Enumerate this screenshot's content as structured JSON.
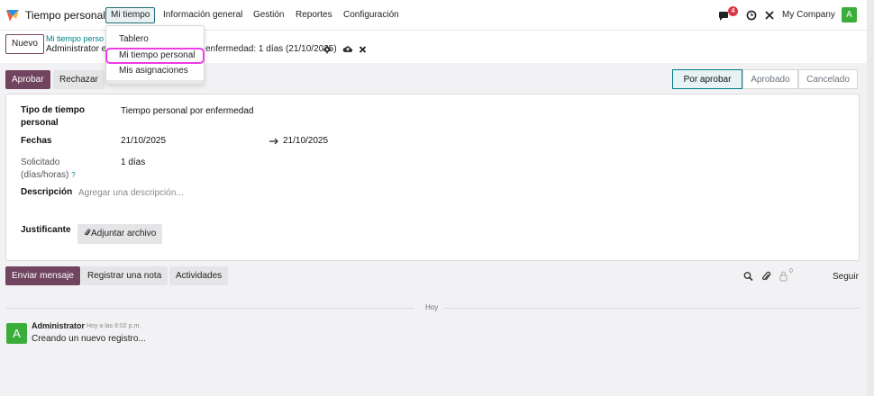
{
  "navbar": {
    "app_name": "Tiempo personal",
    "menu": [
      "Mi tiempo",
      "Información general",
      "Gestión",
      "Reportes",
      "Configuración"
    ],
    "message_count": "4",
    "company": "My Company",
    "user_initial": "A"
  },
  "dropdown": {
    "items": [
      "Tablero",
      "Mi tiempo personal",
      "Mis asignaciones"
    ]
  },
  "breadcrumb": {
    "new_button": "Nuevo",
    "parent": "Mi tiempo perso",
    "record_start": "Administrator e",
    "record_end": "enfermedad: 1 días (21/10/2025)"
  },
  "actions": {
    "approve": "Aprobar",
    "reject": "Rechazar"
  },
  "status": {
    "steps": [
      "Por aprobar",
      "Aprobado",
      "Cancelado"
    ],
    "current": "Por aprobar"
  },
  "form": {
    "type_label_1": "Tipo de tiempo",
    "type_label_2": "personal",
    "type_value": "Tiempo personal por enfermedad",
    "dates_label": "Fechas",
    "date_from": "21/10/2025",
    "date_to": "21/10/2025",
    "requested_label_1": "Solicitado",
    "requested_label_2": "(días/horas)",
    "help_mark": "?",
    "requested_value": "1 días",
    "description_label": "Descripción",
    "description_placeholder": "Agregar una descripción...",
    "attachment_label": "Justificante",
    "attach_button": "Adjuntar archivo"
  },
  "chatter": {
    "send_message": "Enviar mensaje",
    "log_note": "Registrar una nota",
    "activities": "Actividades",
    "follower_count": "0",
    "follow": "Seguir",
    "separator": "Hoy",
    "messages": [
      {
        "avatar": "A",
        "author": "Administrator",
        "time": "Hoy a las 6:02 p.m.",
        "body": "Creando un nuevo registro..."
      }
    ]
  },
  "colors": {
    "primary": "#71445f",
    "accent": "#017e84",
    "highlight": "#ee3be8",
    "badge": "#dc3545",
    "avatar": "#3aad3a"
  }
}
